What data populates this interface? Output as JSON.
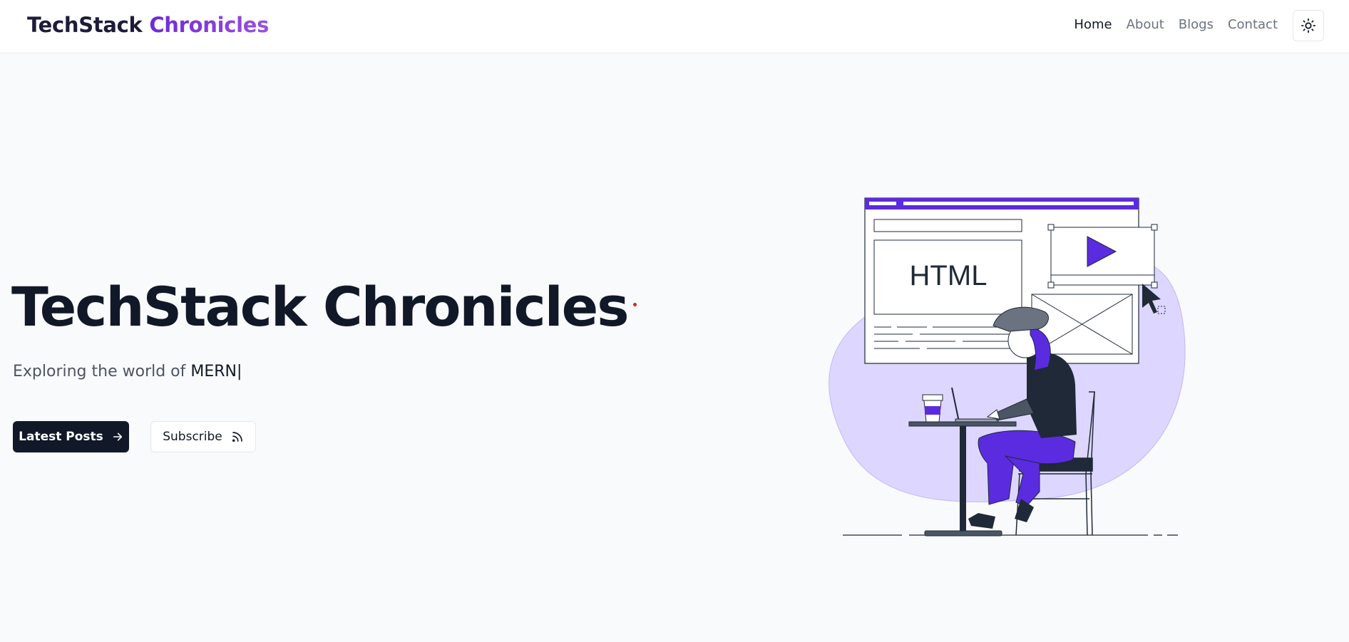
{
  "navbar": {
    "brand_part1": "TechStack",
    "brand_part2": "Chronicles",
    "links": [
      {
        "label": "Home",
        "active": true
      },
      {
        "label": "About",
        "active": false
      },
      {
        "label": "Blogs",
        "active": false
      },
      {
        "label": "Contact",
        "active": false
      }
    ],
    "theme_toggle_icon": "sun-icon"
  },
  "hero": {
    "title": "TechStack Chronicles",
    "subtitle_prefix": "Exploring the world of",
    "subtitle_highlight": "MERN",
    "cursor": "|",
    "primary_button": {
      "label": "Latest Posts",
      "icon": "arrow-right-icon"
    },
    "secondary_button": {
      "label": "Subscribe",
      "icon": "rss-icon"
    }
  },
  "illustration": {
    "code_label": "HTML",
    "accent_color": "#5b2be0",
    "blob_color": "#ddd6fe"
  },
  "colors": {
    "brand_dark": "#1e1b3a",
    "brand_purple": "#7b3fe0",
    "primary_button_bg": "#111827",
    "background": "#f9fafb"
  }
}
